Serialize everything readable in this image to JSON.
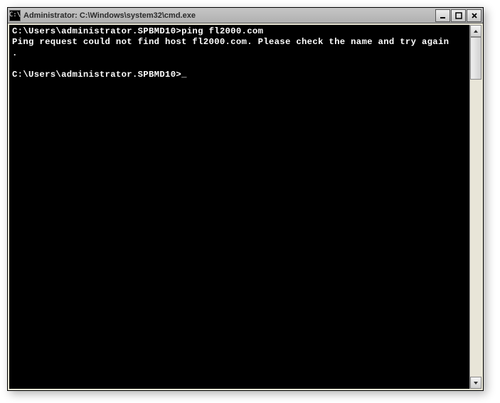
{
  "window": {
    "title": "Administrator: C:\\Windows\\system32\\cmd.exe",
    "icon_glyph": "C:\\"
  },
  "console": {
    "line1_prompt": "C:\\Users\\administrator.SPBMD10>",
    "line1_command": "ping fl2000.com",
    "line2_output": "Ping request could not find host fl2000.com. Please check the name and try again",
    "line3_output": ".",
    "line4_blank": "",
    "line5_prompt": "C:\\Users\\administrator.SPBMD10>",
    "cursor": "_"
  }
}
